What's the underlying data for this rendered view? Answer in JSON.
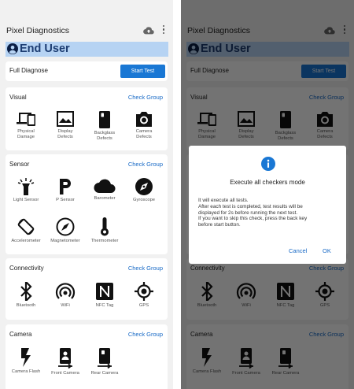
{
  "app": {
    "title": "Pixel Diagnostics"
  },
  "user": {
    "name": "End User"
  },
  "full_diagnose": {
    "label": "Full Diagnose",
    "button": "Start Test"
  },
  "visual": {
    "title": "Visual",
    "check_group": "Check Group",
    "items": [
      {
        "label": "Physical Damage",
        "icon": "devices-icon"
      },
      {
        "label": "Display Defects",
        "icon": "image-icon"
      },
      {
        "label": "Backglass Defects",
        "icon": "phone-back-icon"
      },
      {
        "label": "Camera Defects",
        "icon": "camera-icon"
      }
    ]
  },
  "sensor": {
    "title": "Sensor",
    "check_group": "Check Group",
    "items": [
      {
        "label": "Light Sensor",
        "icon": "flashlight-icon"
      },
      {
        "label": "P Sensor",
        "icon": "proximity-icon"
      },
      {
        "label": "Barometer",
        "icon": "cloud-icon"
      },
      {
        "label": "Gyroscope",
        "icon": "compass-icon"
      },
      {
        "label": "Accelerometer",
        "icon": "screen-rotation-icon"
      },
      {
        "label": "Magnetometer",
        "icon": "compass-icon"
      },
      {
        "label": "Thermometer",
        "icon": "thermometer-icon"
      }
    ]
  },
  "connectivity": {
    "title": "Connectivity",
    "check_group": "Check Group",
    "items": [
      {
        "label": "Bluetooth",
        "icon": "bluetooth-icon"
      },
      {
        "label": "WiFi",
        "icon": "wifi-icon"
      },
      {
        "label": "NFC Tag",
        "icon": "nfc-icon"
      },
      {
        "label": "GPS",
        "icon": "gps-icon"
      }
    ]
  },
  "camera": {
    "title": "Camera",
    "check_group": "Check Group",
    "items": [
      {
        "label": "Camera Flash",
        "icon": "flash-icon"
      },
      {
        "label": "Front Camera",
        "icon": "front-camera-icon"
      },
      {
        "label": "Rear Camera",
        "icon": "rear-camera-icon"
      }
    ]
  },
  "dialog": {
    "title": "Execute all checkers mode",
    "body_lines": [
      "It will execute all tests.",
      "After each test is completed, test results will be",
      "displayed for 2s before running the next test.",
      "If you want to skip this check, press the back key",
      "before start button."
    ],
    "cancel": "Cancel",
    "ok": "OK"
  },
  "colors": {
    "accent": "#1977d4",
    "link": "#1769c6",
    "user_bar": "#b6d3f3",
    "user_text": "#1d3d72"
  }
}
